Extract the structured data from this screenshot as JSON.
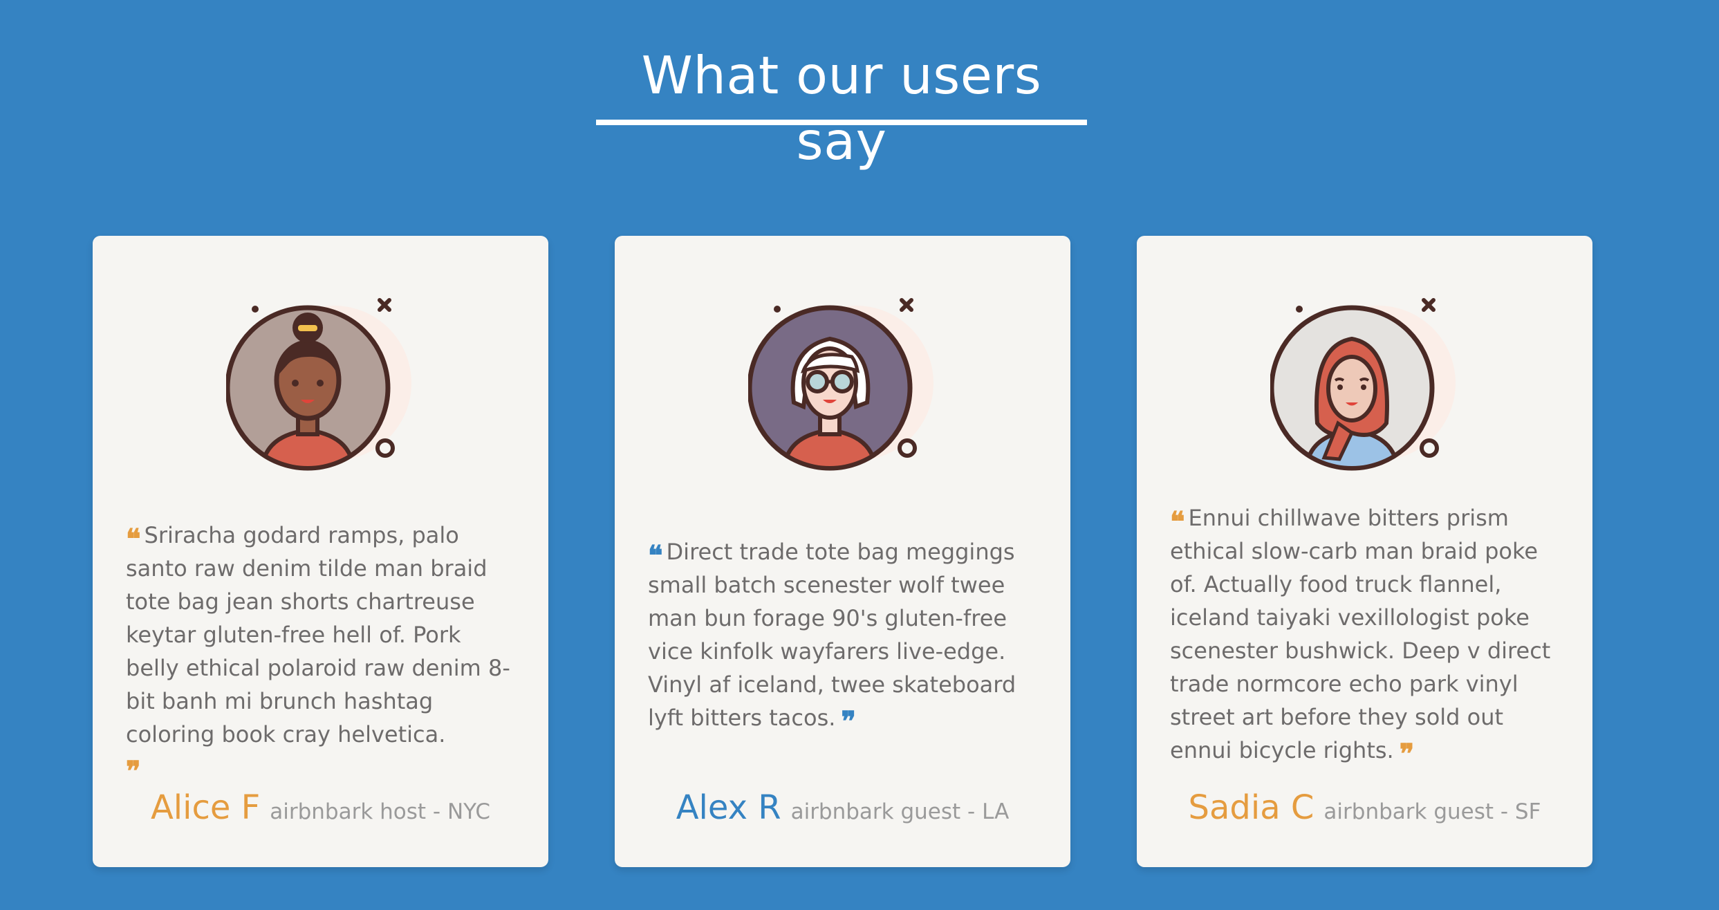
{
  "section": {
    "heading": "What our users say"
  },
  "colors": {
    "background": "#3583c2",
    "card": "#f6f5f2",
    "accent_orange": "#e59c3f",
    "accent_blue": "#3583c2",
    "quote_text": "#6d6b6b",
    "role_text": "#9a9a9a"
  },
  "testimonials": [
    {
      "avatar_icon": "woman-with-bun-avatar-icon",
      "quote": "Sriracha godard ramps, palo santo raw denim tilde man braid tote bag jean shorts chartreuse keytar gluten-free hell of. Pork belly ethical polaroid raw denim 8-bit banh mi brunch hashtag coloring book cray helvetica.",
      "open_mark": "❝",
      "close_mark": "❞",
      "name": "Alice F",
      "role": "airbnbark host - NYC"
    },
    {
      "avatar_icon": "white-haired-person-glasses-avatar-icon",
      "quote": "Direct trade tote bag meggings small batch scenester wolf twee man bun forage 90's gluten-free vice kinfolk wayfarers live-edge. Vinyl af iceland, twee skateboard lyft bitters tacos.",
      "open_mark": "❝",
      "close_mark": "❞",
      "name": "Alex R",
      "role": "airbnbark guest - LA"
    },
    {
      "avatar_icon": "woman-in-hijab-avatar-icon",
      "quote": "Ennui chillwave bitters prism ethical slow-carb man braid poke of. Actually food truck flannel, iceland taiyaki vexillologist poke scenester bushwick. Deep v direct trade normcore echo park vinyl street art before they sold out ennui bicycle rights.",
      "open_mark": "❝",
      "close_mark": "❞",
      "name": "Sadia C",
      "role": "airbnbark guest - SF"
    }
  ]
}
